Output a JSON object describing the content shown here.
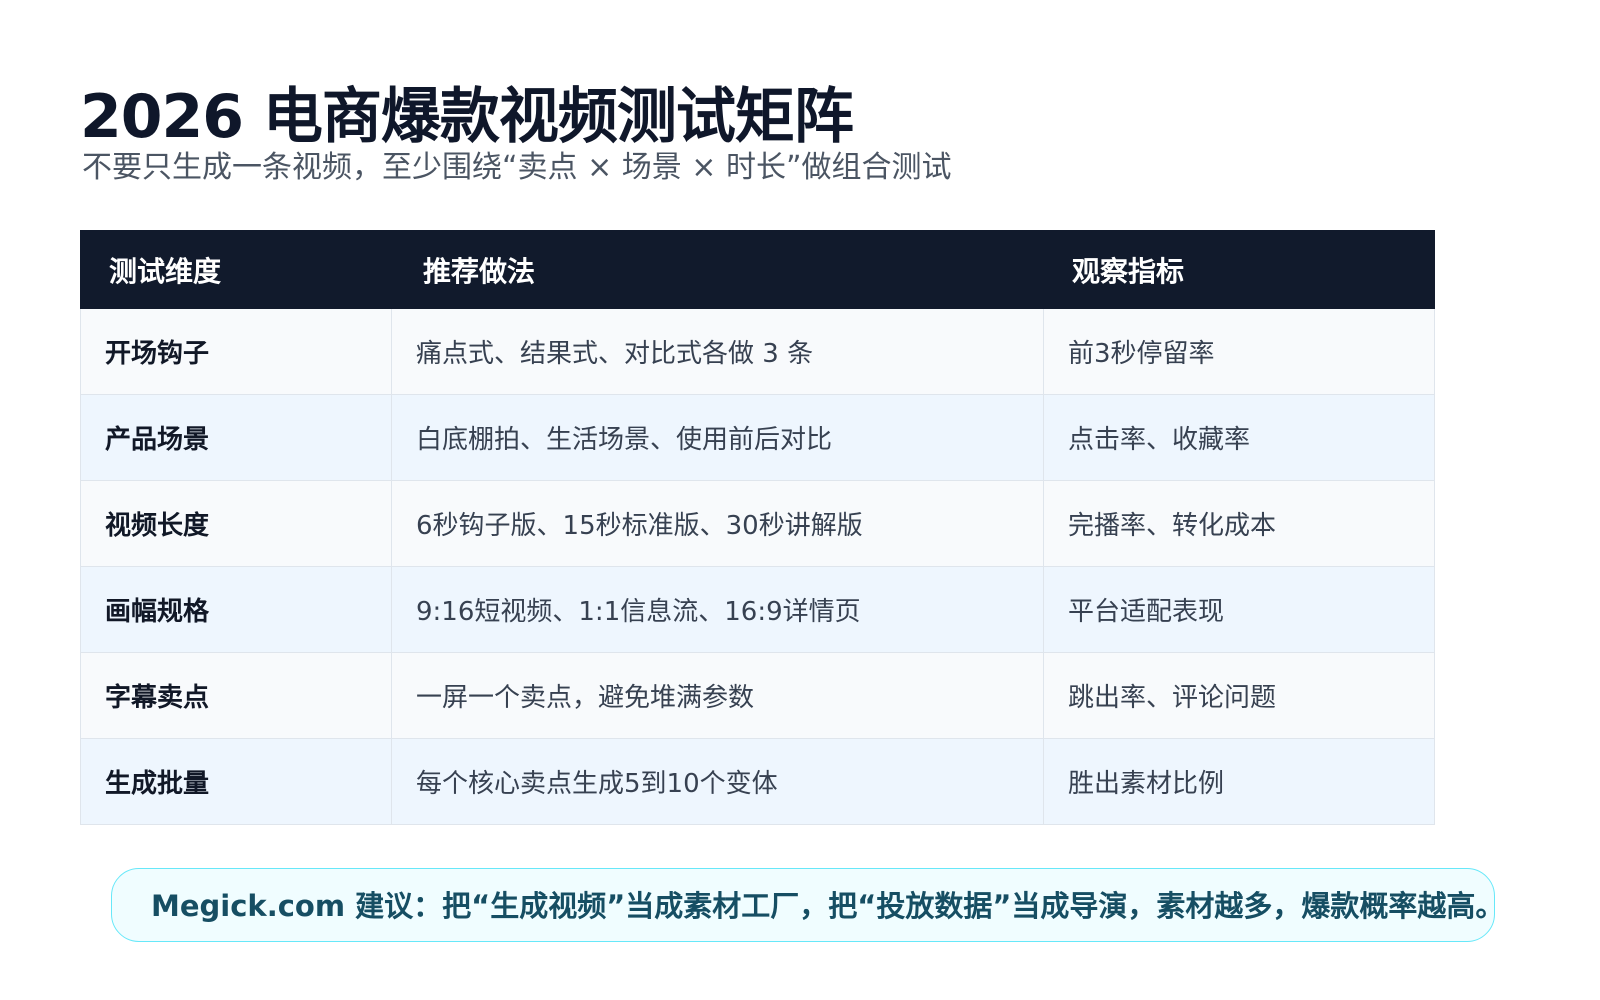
{
  "title": "2026 电商爆款视频测试矩阵",
  "subtitle": "不要只生成一条视频，至少围绕“卖点 × 场景 × 时长”做组合测试",
  "table": {
    "headers": [
      "测试维度",
      "推荐做法",
      "观察指标"
    ],
    "rows": [
      {
        "dimension": "开场钩子",
        "practice": "痛点式、结果式、对比式各做 3 条",
        "metric": "前3秒停留率"
      },
      {
        "dimension": "产品场景",
        "practice": "白底棚拍、生活场景、使用前后对比",
        "metric": "点击率、收藏率"
      },
      {
        "dimension": "视频长度",
        "practice": "6秒钩子版、15秒标准版、30秒讲解版",
        "metric": "完播率、转化成本"
      },
      {
        "dimension": "画幅规格",
        "practice": "9:16短视频、1:1信息流、16:9详情页",
        "metric": "平台适配表现"
      },
      {
        "dimension": "字幕卖点",
        "practice": "一屏一个卖点，避免堆满参数",
        "metric": "跳出率、评论问题"
      },
      {
        "dimension": "生成批量",
        "practice": "每个核心卖点生成5到10个变体",
        "metric": "胜出素材比例"
      }
    ]
  },
  "callout": {
    "text": "Megick.com 建议：把“生成视频”当成素材工厂，把“投放数据”当成导演，素材越多，爆款概率越高。"
  },
  "colors": {
    "header_bg": "#111a2c",
    "row_odd_bg": "#f8fafc",
    "row_even_bg": "#eef6fe",
    "callout_border": "#67e8f9",
    "callout_text": "#164e63"
  }
}
